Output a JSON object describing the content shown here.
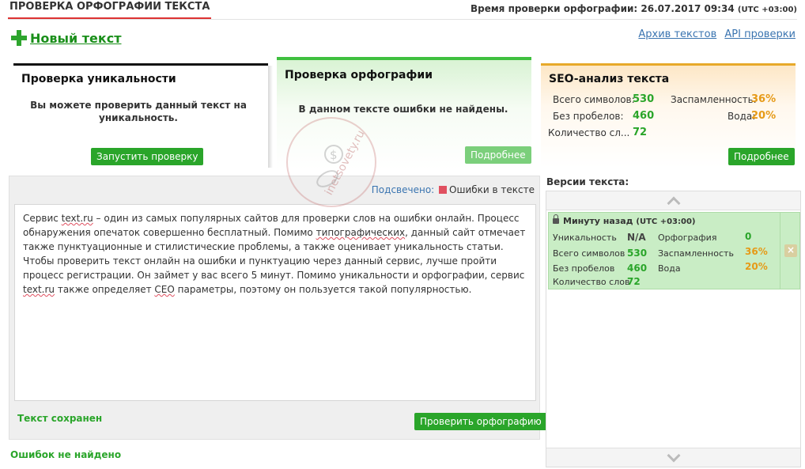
{
  "header": {
    "title": "ПРОВЕРКА ОРФОГРАФИИ ТЕКСТА",
    "check_time_label": "Время проверки орфографии: 26.07.2017 09:34",
    "check_time_tz": "(UTC +03:00)"
  },
  "toolbar": {
    "new_text": "Новый текст",
    "archive_link": "Архив текстов",
    "api_link": "API проверки"
  },
  "cards": {
    "uniqueness": {
      "title": "Проверка уникальности",
      "text": "Вы можете проверить данный текст на уникальность.",
      "button": "Запустить проверку"
    },
    "spelling": {
      "title": "Проверка орфографии",
      "text": "В данном тексте ошибки не найдены.",
      "button": "Подробнее"
    },
    "seo": {
      "title": "SEO-анализ текста",
      "total_chars_label": "Всего символов:",
      "total_chars": "530",
      "spam_label": "Заспамленность:",
      "spam": "36%",
      "no_spaces_label": "Без пробелов:",
      "no_spaces": "460",
      "water_label": "Вода:",
      "water": "20%",
      "words_label": "Количество сл...",
      "words": "72",
      "button": "Подробнее"
    }
  },
  "editor": {
    "highlight_label": "Подсвечено:",
    "highlight_value": "Ошибки в тексте",
    "paragraph1_a": "Сервис ",
    "paragraph1_b": "text.ru",
    "paragraph1_c": " – один из самых популярных сайтов для проверки слов на ошибки онлайн. Процесс обнаружения опечаток совершенно бесплатный. Помимо ",
    "paragraph1_d": "типографических",
    "paragraph1_e": ", данный сайт отмечает также пунктуационные и стилистические проблемы, а также оценивает уникальность статьи.",
    "paragraph2_a": "Чтобы проверить текст онлайн на ошибки и пунктуацию через данный сервис, лучше пройти процесс регистрации. Он займет у вас всего 5 минут. Помимо уникальности и орфографии, сервис ",
    "paragraph2_b": "text.ru",
    "paragraph2_c": " также определяет ",
    "paragraph2_d": "СЕО",
    "paragraph2_e": " параметры, поэтому он пользуется такой популярностью.",
    "saved_status": "Текст сохранен",
    "check_button": "Проверить орфографию"
  },
  "footer": {
    "no_errors": "Ошибок не найдено"
  },
  "versions": {
    "title": "Версии текста:",
    "item": {
      "time": "Минуту назад",
      "tz": "(UTC +03:00)",
      "uniq_label": "Уникальность",
      "uniq": "N/A",
      "spell_label": "Орфография",
      "spell": "0",
      "total_label": "Всего символов",
      "total": "530",
      "spam_label": "Заспамленность",
      "spam": "36%",
      "nospace_label": "Без пробелов",
      "nospace": "460",
      "water_label": "Вода",
      "water": "20%",
      "words_label": "Количество слов",
      "words": "72"
    }
  },
  "watermark": {
    "text": "inetsovety.ru"
  },
  "colors": {
    "green": "#2aa52a",
    "orange": "#e69a17",
    "link": "#3a74b0",
    "accent_red": "#dd3333"
  }
}
